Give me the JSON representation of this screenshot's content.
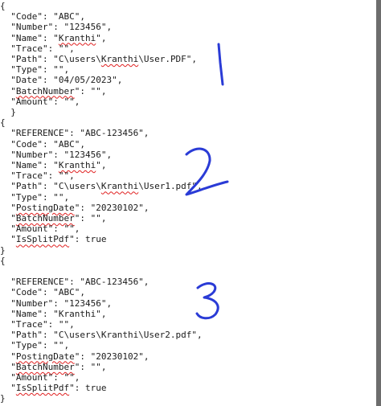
{
  "editor": {
    "lines": [
      [
        {
          "t": "{"
        }
      ],
      [
        {
          "t": "  \"Code\": \"ABC\","
        }
      ],
      [
        {
          "t": "  \"Number\": \"123456\","
        }
      ],
      [
        {
          "t": "  \"Name\": \""
        },
        {
          "t": "Kranthi",
          "sq": true
        },
        {
          "t": "\","
        }
      ],
      [
        {
          "t": "  \"Trace\": \"\","
        }
      ],
      [
        {
          "t": "  \"Path\": \"C\\users\\"
        },
        {
          "t": "Kranthi",
          "sq": true
        },
        {
          "t": "\\User.PDF\","
        }
      ],
      [
        {
          "t": "  \"Type\": \"\","
        }
      ],
      [
        {
          "t": "  \"Date\": \"04/05/2023\","
        }
      ],
      [
        {
          "t": "  \""
        },
        {
          "t": "BatchNumber",
          "sq": true
        },
        {
          "t": "\": \"\","
        }
      ],
      [
        {
          "t": "  \"Amount\": \"\","
        }
      ],
      [
        {
          "t": "  }"
        }
      ],
      [
        {
          "t": "{"
        }
      ],
      [
        {
          "t": "  \"REFERENCE\": \"ABC-123456\","
        }
      ],
      [
        {
          "t": "  \"Code\": \"ABC\","
        }
      ],
      [
        {
          "t": "  \"Number\": \"123456\","
        }
      ],
      [
        {
          "t": "  \"Name\": \""
        },
        {
          "t": "Kranthi",
          "sq": true
        },
        {
          "t": "\","
        }
      ],
      [
        {
          "t": "  \"Trace\": \"\","
        }
      ],
      [
        {
          "t": "  \"Path\": \"C\\users\\"
        },
        {
          "t": "Kranthi",
          "sq": true
        },
        {
          "t": "\\User1.pdf\","
        }
      ],
      [
        {
          "t": "  \"Type\": \"\","
        }
      ],
      [
        {
          "t": "  \""
        },
        {
          "t": "PostingDate",
          "sq": true
        },
        {
          "t": "\": \"20230102\","
        }
      ],
      [
        {
          "t": "  \""
        },
        {
          "t": "BatchNumber",
          "sq": true
        },
        {
          "t": "\": \"\","
        }
      ],
      [
        {
          "t": "  \"Amount\": \"\","
        }
      ],
      [
        {
          "t": "  \""
        },
        {
          "t": "IsSplitPdf",
          "sq": true
        },
        {
          "t": "\": true"
        }
      ],
      [
        {
          "t": "}"
        }
      ],
      [
        {
          "t": "{"
        }
      ],
      [
        {
          "t": ""
        }
      ],
      [
        {
          "t": "  \"REFERENCE\": \"ABC-123456\","
        }
      ],
      [
        {
          "t": "  \"Code\": \"ABC\","
        }
      ],
      [
        {
          "t": "  \"Number\": \"123456\","
        }
      ],
      [
        {
          "t": "  \"Name\": \"Kranthi\","
        }
      ],
      [
        {
          "t": "  \"Trace\": \"\","
        }
      ],
      [
        {
          "t": "  \"Path\": \"C\\users\\Kranthi\\User2.pdf\","
        }
      ],
      [
        {
          "t": "  \"Type\": \"\","
        }
      ],
      [
        {
          "t": "  \""
        },
        {
          "t": "PostingDate",
          "sq": true
        },
        {
          "t": "\": \"20230102\","
        }
      ],
      [
        {
          "t": "  \""
        },
        {
          "t": "BatchNumber",
          "sq": true
        },
        {
          "t": "\": \"\","
        }
      ],
      [
        {
          "t": "  \"Amount\": \"\","
        }
      ],
      [
        {
          "t": "  \""
        },
        {
          "t": "IsSplitPdf",
          "sq": true
        },
        {
          "t": "\": true"
        }
      ],
      [
        {
          "t": "}"
        }
      ]
    ]
  },
  "annotations": [
    {
      "label": "1",
      "color": "#2a3bd6"
    },
    {
      "label": "2",
      "color": "#2a3bd6"
    },
    {
      "label": "3",
      "color": "#2a3bd6"
    }
  ],
  "colors": {
    "text": "#1a1a1a",
    "spellcheck_underline": "#e02020",
    "annotation_ink": "#2a3bd6",
    "scrollbar_thumb": "#6d6d6d"
  }
}
